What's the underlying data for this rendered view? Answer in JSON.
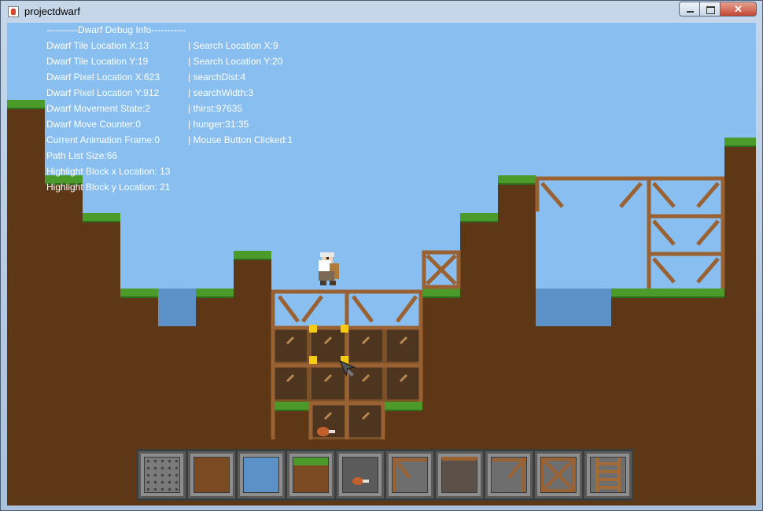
{
  "window": {
    "title": "projectdwarf"
  },
  "debug": {
    "header": "----------Dwarf Debug Info-----------",
    "left": [
      "Dwarf Tile Location X:13",
      "Dwarf Tile Location Y:19",
      "Dwarf Pixel Location X:623",
      "Dwarf Pixel Location Y:912",
      "Dwarf Movement State:2",
      "Dwarf Move Counter:0",
      "Current Animation Frame:0",
      "Path List Size:66",
      "Highlight Block x Location: 13",
      "Highlight Block y Location: 21"
    ],
    "right": [
      "| Search Location X:9",
      "| Search Location Y:20",
      "| searchDist:4",
      "| searchWidth:3",
      "| thirst:97635",
      "| hunger:31:35",
      "| Mouse Button Clicked:1"
    ]
  },
  "colors": {
    "sky": "#88bff0",
    "dirt": "#7a4b22",
    "grass": "#4b9a2a",
    "water": "#5c91c8",
    "wood": "#a46b37",
    "highlight": "#f5cc12"
  },
  "hotbar": {
    "slots": [
      {
        "icon": "stone-block-icon"
      },
      {
        "icon": "dirt-block-icon"
      },
      {
        "icon": "water-block-icon"
      },
      {
        "icon": "grass-block-icon"
      },
      {
        "icon": "meat-item-icon"
      },
      {
        "icon": "scaffold-corner-icon"
      },
      {
        "icon": "wood-wall-icon"
      },
      {
        "icon": "scaffold-brace-icon"
      },
      {
        "icon": "scaffold-cross-icon"
      },
      {
        "icon": "ladder-icon"
      }
    ]
  }
}
